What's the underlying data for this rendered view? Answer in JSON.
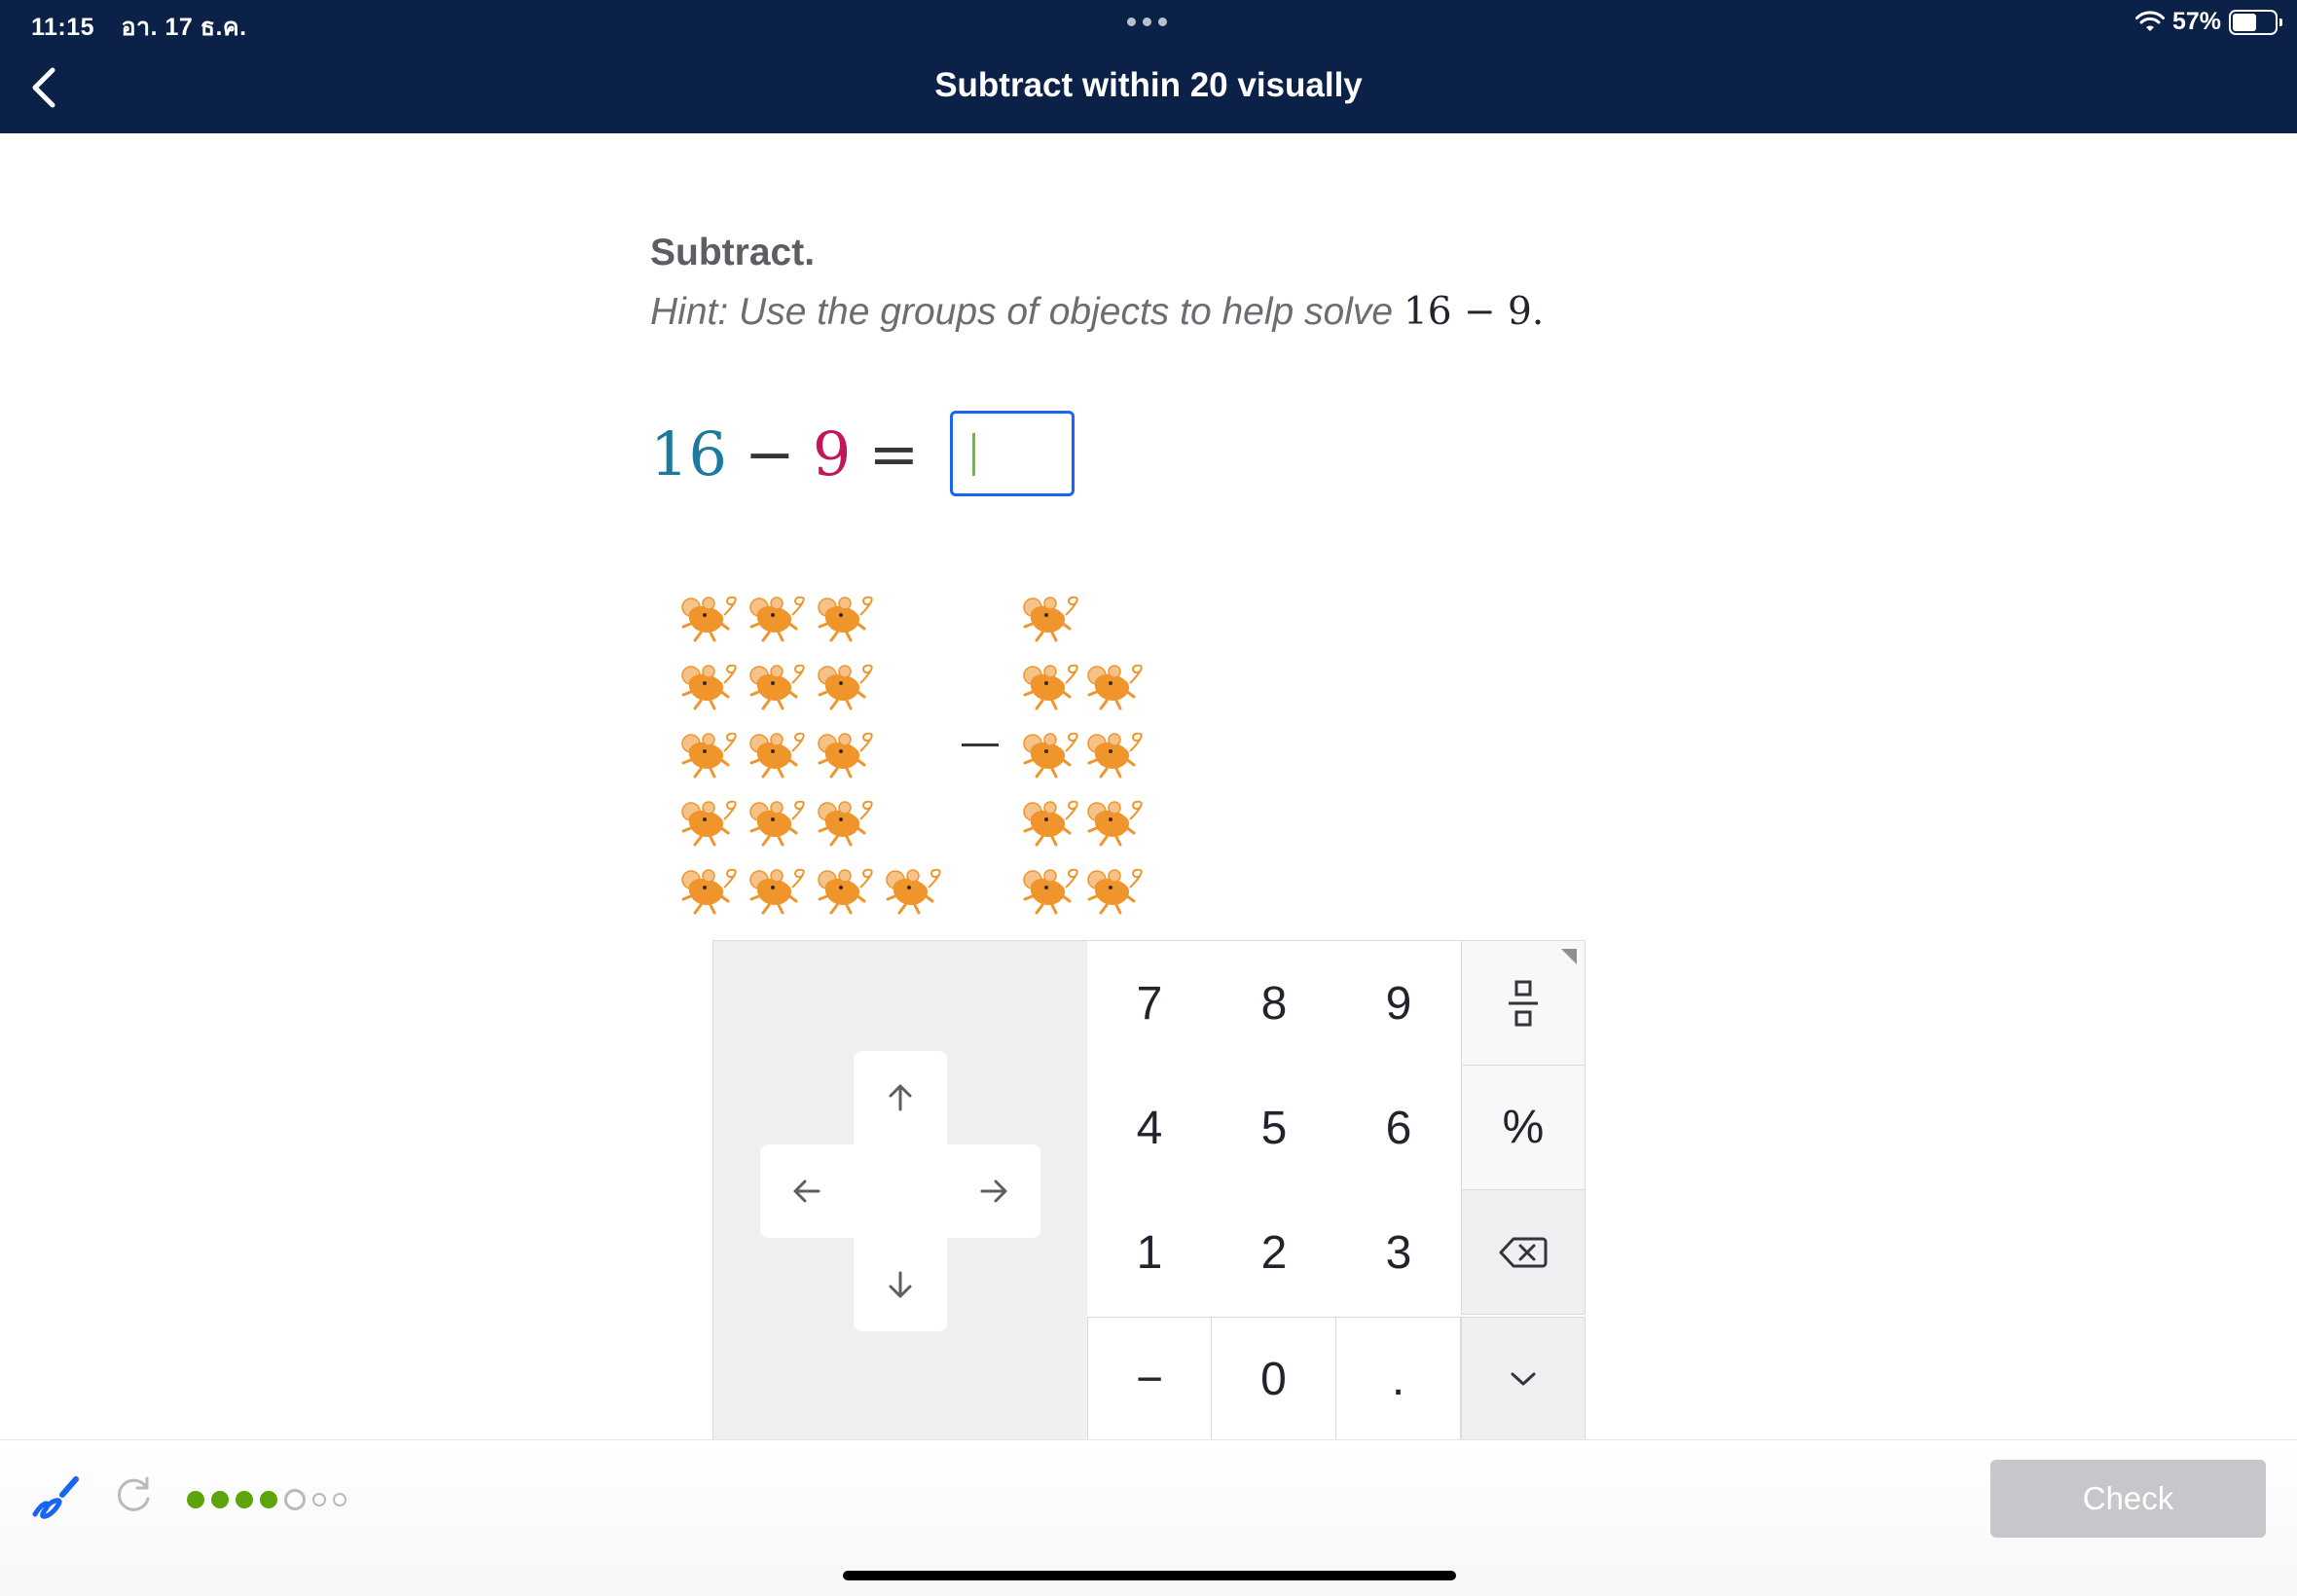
{
  "status_bar": {
    "time": "11:15",
    "date": "อา. 17 ธ.ค.",
    "battery": "57%",
    "battery_level": 0.57
  },
  "header": {
    "title": "Subtract within 20 visually"
  },
  "question": {
    "instruction": "Subtract.",
    "hint_text": "Hint: Use the groups of objects to help solve",
    "hint_expression": "16 − 9",
    "hint_end": ".",
    "equation": {
      "a": "16",
      "op": "−",
      "b": "9",
      "eq": "="
    },
    "answer_value": ""
  },
  "visual": {
    "left_group_count": 16,
    "right_group_count": 9,
    "object_icon": "mouse-icon",
    "operator": "−"
  },
  "keypad": {
    "digits": [
      "7",
      "8",
      "9",
      "4",
      "5",
      "6",
      "1",
      "2",
      "3",
      "−",
      "0",
      "."
    ],
    "fraction_icon": "fraction-icon",
    "percent": "%",
    "backspace_icon": "backspace-icon",
    "dismiss_icon": "chevron-down-icon",
    "arrows": [
      "arrow-up-icon",
      "arrow-left-icon",
      "arrow-right-icon",
      "arrow-down-icon"
    ]
  },
  "footer": {
    "check_label": "Check",
    "progress": {
      "completed": 4,
      "current": 5,
      "total": 7
    }
  },
  "colors": {
    "header_bg": "#0c2148",
    "accent": "#1865f2",
    "minuend": "#1d7a9b",
    "subtrahend": "#c2185b",
    "progress_done": "#5da40a",
    "mouse": "#f0952c"
  }
}
